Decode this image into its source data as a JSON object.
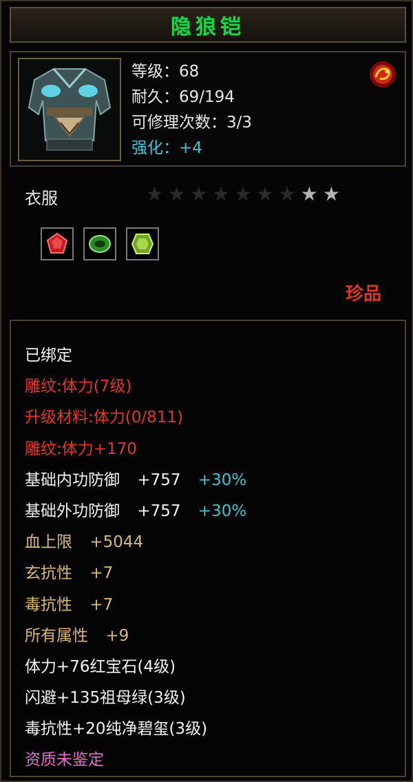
{
  "item": {
    "title": "隐狼铠",
    "level": "等级：68",
    "durability": "耐久：69/194",
    "repair_count": "可修理次数：3/3",
    "enhance": "强化：+4",
    "category": "衣服",
    "stars_total": 9,
    "stars_lit": 2,
    "rarity": "珍品",
    "sockets": [
      {
        "icon": "ruby-gem-icon",
        "color": "#d42a2a"
      },
      {
        "icon": "emerald-gem-icon",
        "color": "#3fae3a"
      },
      {
        "icon": "jade-gem-icon",
        "color": "#8fd03a"
      }
    ]
  },
  "attributes": {
    "bound": "已绑定",
    "engrave": "雕纹:体力(7级)",
    "upgrade_material": "升级材料:体力(0/811)",
    "engrave_bonus": "雕纹:体力+170",
    "inner_def": {
      "label": "基础内功防御",
      "value": "+757",
      "pct": "+30%"
    },
    "outer_def": {
      "label": "基础外功防御",
      "value": "+757",
      "pct": "+30%"
    },
    "hp": {
      "label": "血上限",
      "value": "+5044"
    },
    "mystic_res": {
      "label": "玄抗性",
      "value": "+7"
    },
    "poison_res": {
      "label": "毒抗性",
      "value": "+7"
    },
    "all_attr": {
      "label": "所有属性",
      "value": "+9"
    },
    "gem1": "体力+76红宝石(4级)",
    "gem2": "闪避+135祖母绿(3级)",
    "gem3": "毒抗性+20纯净碧玺(3级)",
    "aptitude": "资质未鉴定"
  },
  "colors": {
    "title": "#21d14a",
    "enhance": "#37c9d6",
    "red": "#e2372c",
    "gold": "#d8b878",
    "pink": "#e070c8",
    "percent": "#38c8d0"
  }
}
